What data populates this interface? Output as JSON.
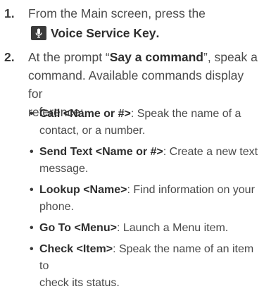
{
  "steps": [
    {
      "number": "1.",
      "text_before": "From the Main screen, press the",
      "key_icon": "microphone-icon",
      "key_label": "Voice Service Key",
      "text_after": "."
    },
    {
      "number": "2.",
      "text_prefix": "At the prompt “",
      "prompt": "Say a command",
      "text_suffix_line1": "”, speak a",
      "text_line2": "command. Available commands display for",
      "text_line3": "reference:"
    }
  ],
  "commands": [
    {
      "name": "Call <Name or #>",
      "desc_line1": ": Speak the name of a",
      "desc_line2": "contact, or a number."
    },
    {
      "name": "Send Text <Name or #>",
      "desc_line1": ": Create a new text",
      "desc_line2": "message."
    },
    {
      "name": "Lookup <Name>",
      "desc_line1": ": Find information on your",
      "desc_line2": "phone."
    },
    {
      "name": "Go To <Menu>",
      "desc_line1": ": Launch a Menu item.",
      "desc_line2": ""
    },
    {
      "name": "Check <Item>",
      "desc_line1": ": Speak the name of an item to",
      "desc_line2": "check its status."
    }
  ],
  "bullet_glyph": "•",
  "colors": {
    "text": "#4a4a4a",
    "bold": "#2e2e2e",
    "icon_bg": "#3a3a3a",
    "icon_fg": "#ffffff"
  }
}
